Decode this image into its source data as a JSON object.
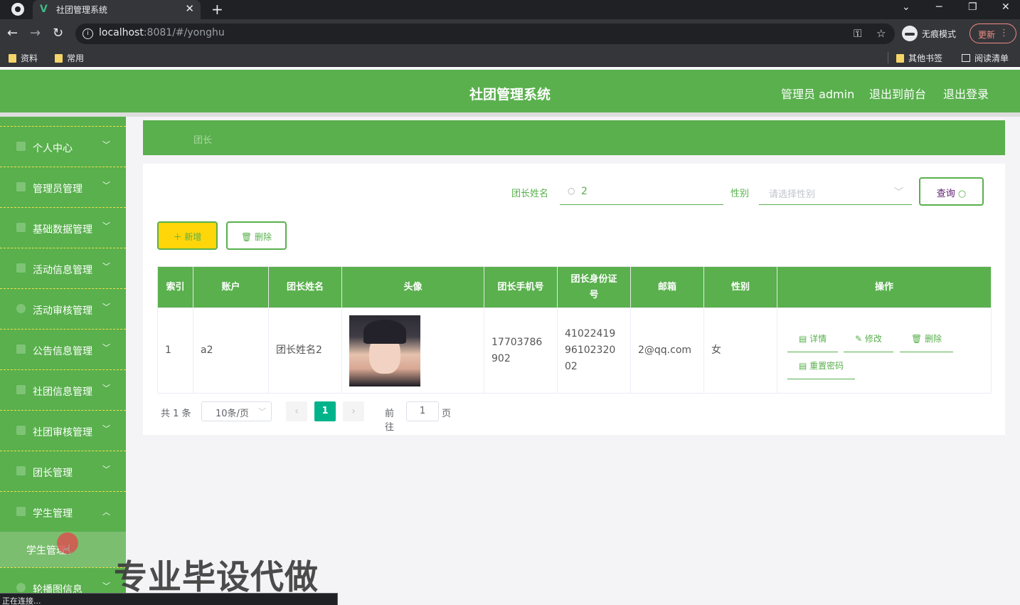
{
  "browser": {
    "tab_title": "社团管理系统",
    "url_host": "localhost",
    "url_rest": ":8081/#/yonghu",
    "incognito_label": "无痕模式",
    "update_label": "更新",
    "bookmarks": [
      "资料",
      "常用"
    ],
    "other_bookmarks": "其他书签",
    "reading_list": "阅读清单",
    "status": "正在连接..."
  },
  "header": {
    "title": "社团管理系统",
    "admin_label": "管理员 admin",
    "front_label": "退出到前台",
    "logout_label": "退出登录"
  },
  "sidebar": {
    "items": [
      {
        "label": "个人中心",
        "icon": "user-icon"
      },
      {
        "label": "管理员管理",
        "icon": "bookmark-icon"
      },
      {
        "label": "基础数据管理",
        "icon": "grid-icon"
      },
      {
        "label": "活动信息管理",
        "icon": "calendar-icon"
      },
      {
        "label": "活动审核管理",
        "icon": "clock-icon"
      },
      {
        "label": "公告信息管理",
        "icon": "notice-icon"
      },
      {
        "label": "社团信息管理",
        "icon": "group-icon"
      },
      {
        "label": "社团审核管理",
        "icon": "list-icon"
      },
      {
        "label": "团长管理",
        "icon": "flag-icon"
      },
      {
        "label": "学生管理",
        "icon": "chart-icon"
      }
    ],
    "submenu_label": "学生管理",
    "last_label": "轮播图信息"
  },
  "breadcrumb": "团长",
  "filter": {
    "name_label": "团长姓名",
    "name_value": "2",
    "gender_label": "性别",
    "gender_placeholder": "请选择性别",
    "query_label": "查询"
  },
  "actions": {
    "add_label": "新增",
    "delete_label": "删除"
  },
  "table": {
    "headers": [
      "索引",
      "账户",
      "团长姓名",
      "头像",
      "团长手机号",
      "团长身份证号",
      "邮箱",
      "性别",
      "操作"
    ],
    "rows": [
      {
        "index": "1",
        "account": "a2",
        "name": "团长姓名2",
        "phone": "17703786902",
        "id_card": "410224199610232002",
        "email": "2@qq.com",
        "gender": "女"
      }
    ],
    "op_labels": {
      "detail": "详情",
      "edit": "修改",
      "delete": "删除",
      "reset": "重置密码"
    }
  },
  "pagination": {
    "total_text": "共 1 条",
    "page_size": "10条/页",
    "current_page": "1",
    "goto_label": "前往",
    "goto_value": "1",
    "page_suffix": "页"
  },
  "watermark": "专业毕设代做"
}
